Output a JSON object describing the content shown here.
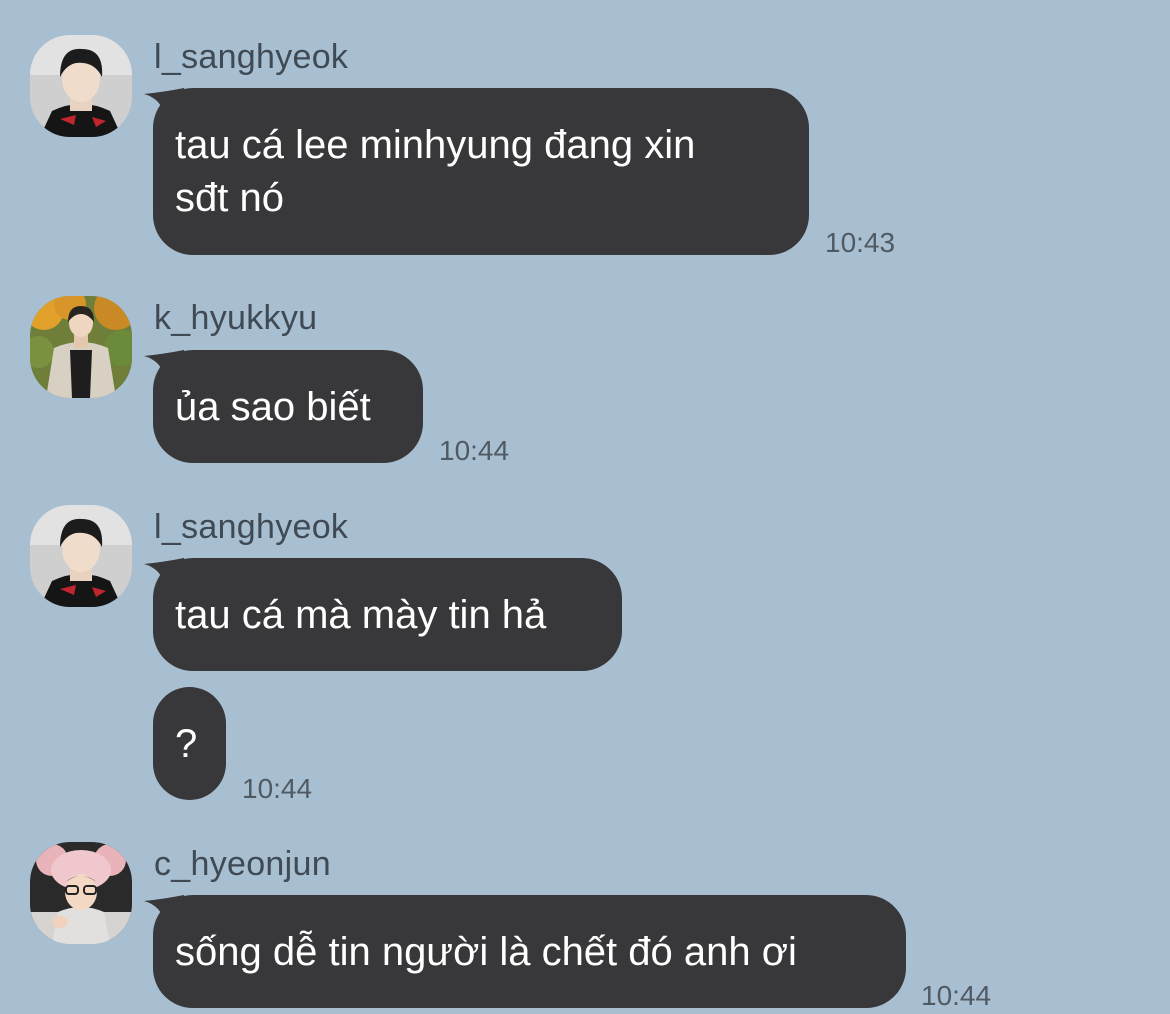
{
  "messages": [
    {
      "sender": "l_sanghyeok",
      "avatar": "avatar-sanghyeok",
      "lines": [
        "tau cá lee minhyung đang xin",
        "sđt nó"
      ],
      "time": "10:43"
    },
    {
      "sender": "k_hyukkyu",
      "avatar": "avatar-hyukkyu",
      "lines": [
        "ủa sao biết"
      ],
      "time": "10:44"
    },
    {
      "sender": "l_sanghyeok",
      "avatar": "avatar-sanghyeok",
      "lines": [
        "tau cá mà mày tin hả"
      ],
      "time": ""
    },
    {
      "sender": "l_sanghyeok",
      "avatar": "",
      "lines": [
        "?"
      ],
      "time": "10:44"
    },
    {
      "sender": "c_hyeonjun",
      "avatar": "avatar-hyeonjun",
      "lines": [
        "sống dễ tin người là chết đó anh ơi"
      ],
      "time": "10:44"
    }
  ],
  "colors": {
    "background": "#a8bfd1",
    "bubble": "#38383a",
    "bubble_text": "#ffffff",
    "name_text": "#3f4a54",
    "time_text": "#505a63"
  }
}
